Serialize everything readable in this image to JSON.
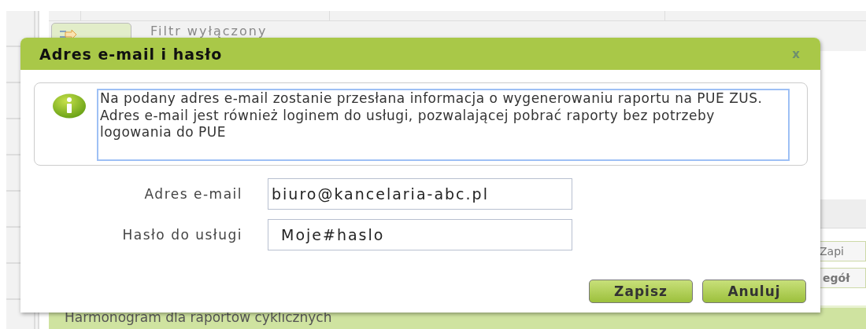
{
  "background": {
    "filter_status": "Filtr wyłączony",
    "side_buttons": [
      "Zapi",
      "egół"
    ],
    "section_title": "Harmonogram dla raportów cyklicznych"
  },
  "dialog": {
    "title": "Adres e-mail i hasło",
    "close": "x",
    "info": [
      "Na podany adres e-mail zostanie przesłana informacja o wygenerowaniu raportu na PUE ZUS.",
      "Adres e-mail jest również loginem do usługi, pozwalającej pobrać raporty bez potrzeby logowania do PUE"
    ],
    "fields": [
      {
        "label": "Adres e-mail",
        "value": "biuro@kancelaria-abc.pl"
      },
      {
        "label": "Hasło do usługi",
        "value": "Moje#haslo"
      }
    ],
    "buttons": [
      "Zapisz",
      "Anuluj"
    ]
  }
}
